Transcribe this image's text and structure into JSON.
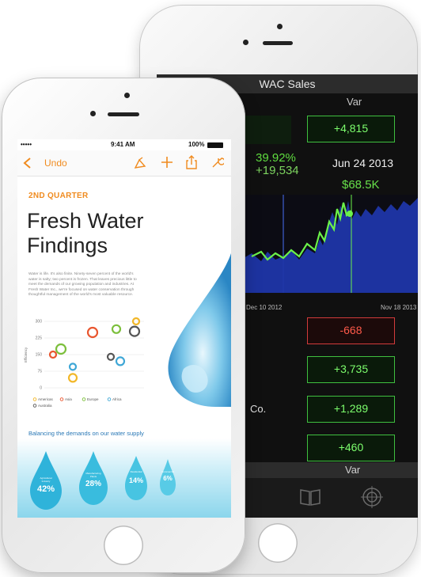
{
  "front": {
    "status": {
      "carrier": "•••••",
      "time": "9:41 AM",
      "battery": "100%"
    },
    "toolbar": {
      "undo_label": "Undo"
    },
    "section_label": "2ND QUARTER",
    "title_line1": "Fresh Water",
    "title_line2": "Findings",
    "body": [
      "Water is life. It's also finite. Ninety-seven percent of the world's",
      "water is salty; two percent is frozen. That leaves precious little to",
      "meet the demands of our growing population and industries. At",
      "Fresh Water Inc., we're focused on water conservation through",
      "thoughtful management of the world's most valuable resource."
    ],
    "chart_ylabel": "Efficiency",
    "caption": "Balancing the demands on our water supply",
    "drops": [
      {
        "label": "Agricultural Industry",
        "value": "42%"
      },
      {
        "label": "Manufacturing Plants",
        "value": "28%"
      },
      {
        "label": "Residential",
        "value": "14%"
      },
      {
        "label": "Commercial",
        "value": "6%"
      }
    ],
    "colors": {
      "accent": "#f08b1f",
      "caption": "#2a78b6"
    }
  },
  "back": {
    "title": "WAC Sales",
    "col_var_top": "Var",
    "col_var_bottom": "Var",
    "var_values": [
      "+4,815",
      "-668",
      "+3,735",
      "+1,289",
      "+460"
    ],
    "stat_pct": "39.92%",
    "stat_delta": "+19,534",
    "stat_date": "Jun 24 2013",
    "stat_price": "$68.5K",
    "date_left": "Dec 10 2012",
    "date_right": "Nov 18 2013",
    "row_text": "Co.",
    "tab_icons": [
      "book-icon",
      "target-icon"
    ],
    "colors": {
      "positive": "#7dff6d",
      "negative": "#ff5a4a"
    }
  },
  "chart_data": {
    "type": "scatter",
    "yticks": [
      "300",
      "225",
      "150",
      "75",
      "0"
    ],
    "ylabel": "Efficiency",
    "legend": [
      "Americas",
      "Asia",
      "Europe",
      "Africa",
      "Australia"
    ],
    "series_colors": [
      "#f2b728",
      "#e9562f",
      "#7cbf3c",
      "#3fa7d6",
      "#555555"
    ],
    "points": [
      {
        "series": "Americas",
        "y": 300
      },
      {
        "series": "Americas",
        "y": 45
      },
      {
        "series": "Asia",
        "y": 250
      },
      {
        "series": "Asia",
        "y": 150
      },
      {
        "series": "Europe",
        "y": 265
      },
      {
        "series": "Europe",
        "y": 175
      },
      {
        "series": "Africa",
        "y": 95
      },
      {
        "series": "Africa",
        "y": 120
      },
      {
        "series": "Australia",
        "y": 255
      },
      {
        "series": "Australia",
        "y": 140
      }
    ]
  }
}
